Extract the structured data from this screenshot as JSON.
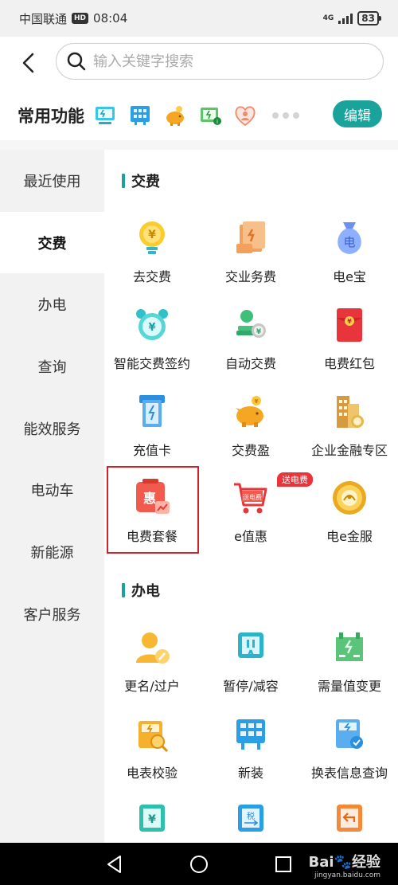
{
  "status_bar": {
    "carrier": "中国联通",
    "hd": "HD",
    "time": "08:04",
    "network": "4G",
    "battery": "83"
  },
  "header": {
    "search_placeholder": "输入关键字搜索"
  },
  "common": {
    "title": "常用功能",
    "icons": [
      "monitor-icon",
      "grid-panel-icon",
      "piggy-bank-icon",
      "charger-icon",
      "heart-icon"
    ],
    "edit_label": "编辑"
  },
  "sidebar": {
    "items": [
      {
        "label": "最近使用"
      },
      {
        "label": "交费",
        "active": true
      },
      {
        "label": "办电"
      },
      {
        "label": "查询"
      },
      {
        "label": "能效服务"
      },
      {
        "label": "电动车"
      },
      {
        "label": "新能源"
      },
      {
        "label": "客户服务"
      }
    ]
  },
  "sections": [
    {
      "title": "交费",
      "items": [
        {
          "label": "去交费",
          "icon": "gold-bulb-icon"
        },
        {
          "label": "交业务费",
          "icon": "document-icon"
        },
        {
          "label": "电e宝",
          "icon": "money-bag-icon"
        },
        {
          "label": "智能交费签约",
          "icon": "alarm-clock-icon"
        },
        {
          "label": "自动交费",
          "icon": "coin-stack-icon"
        },
        {
          "label": "电费红包",
          "icon": "red-envelope-icon"
        },
        {
          "label": "充值卡",
          "icon": "card-slot-icon"
        },
        {
          "label": "交费盈",
          "icon": "piggy-bank-icon"
        },
        {
          "label": "企业金融专区",
          "icon": "building-icon"
        },
        {
          "label": "电费套餐",
          "icon": "package-icon",
          "highlighted": true
        },
        {
          "label": "e值惠",
          "icon": "cart-icon",
          "badge": "送电费"
        },
        {
          "label": "电e金服",
          "icon": "gold-coin-icon"
        }
      ]
    },
    {
      "title": "办电",
      "items": [
        {
          "label": "更名/过户",
          "icon": "user-edit-icon"
        },
        {
          "label": "暂停/减容",
          "icon": "pause-icon"
        },
        {
          "label": "需量值变更",
          "icon": "factory-icon"
        },
        {
          "label": "电表校验",
          "icon": "meter-check-icon"
        },
        {
          "label": "新装",
          "icon": "new-install-icon"
        },
        {
          "label": "换表信息查询",
          "icon": "meter-search-icon"
        },
        {
          "label": "",
          "icon": "yuan-icon"
        },
        {
          "label": "",
          "icon": "tax-icon"
        },
        {
          "label": "",
          "icon": "return-icon"
        }
      ]
    }
  ],
  "colors": {
    "accent": "#1aa39b",
    "highlight": "#d4202a",
    "badge": "#e8353b"
  }
}
